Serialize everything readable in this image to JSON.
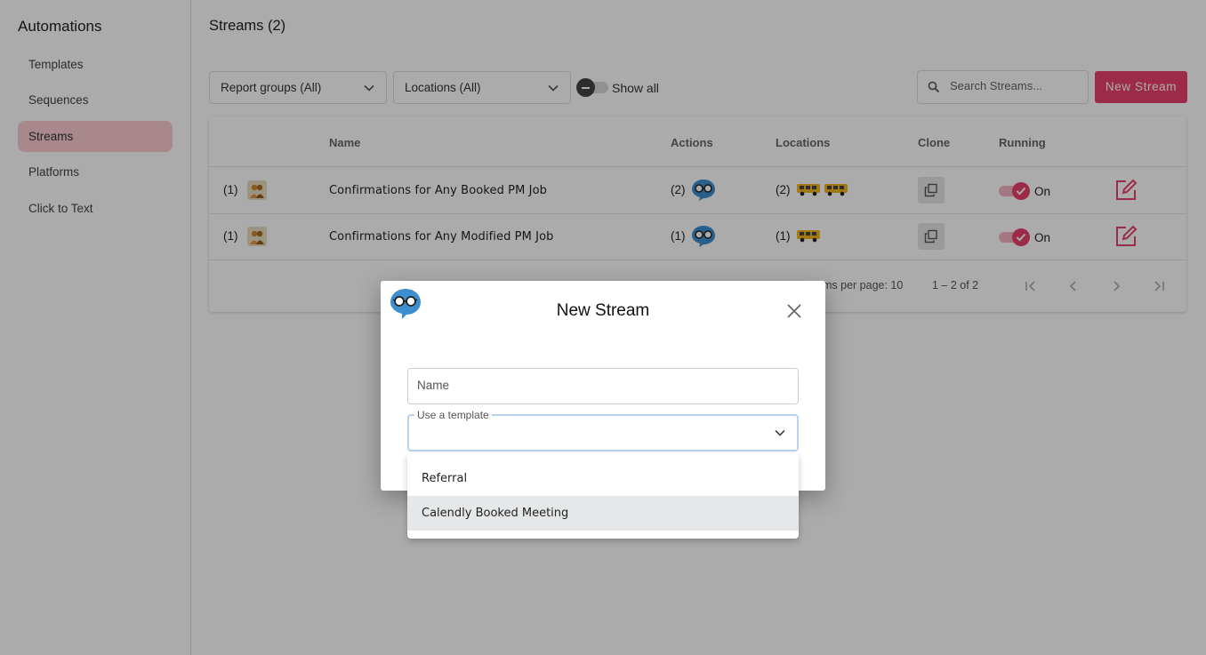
{
  "sidebar": {
    "title": "Automations",
    "items": [
      {
        "label": "Templates"
      },
      {
        "label": "Sequences"
      },
      {
        "label": "Streams"
      },
      {
        "label": "Platforms"
      },
      {
        "label": "Click to Text"
      }
    ]
  },
  "header": {
    "title": "Streams (2)",
    "report_groups_select": "Report groups (All)",
    "locations_select": "Locations (All)",
    "show_all_label": "Show all",
    "search_placeholder": "Search Streams...",
    "new_stream_label": "New Stream"
  },
  "table": {
    "columns": [
      "Name",
      "Actions",
      "Locations",
      "Clone",
      "Running"
    ],
    "rows": [
      {
        "count": "(1)",
        "name": "Confirmations for Any Booked PM Job",
        "actions": "(2)",
        "locations": "(2)",
        "running": "On"
      },
      {
        "count": "(1)",
        "name": "Confirmations for Any Modified PM Job",
        "actions": "(1)",
        "locations": "(1)",
        "running": "On"
      }
    ],
    "pagination": {
      "items_per_page_label": "ms per page: 10",
      "range": "1 – 2 of 2"
    }
  },
  "dialog": {
    "title": "New Stream",
    "name_placeholder": "Name",
    "template_label": "Use a template",
    "template_options": [
      "Referral",
      "Calendly Booked Meeting"
    ]
  },
  "colors": {
    "accent": "#e8416e",
    "active_nav": "#fbc9d3",
    "focus_border": "#b6d2ef"
  }
}
